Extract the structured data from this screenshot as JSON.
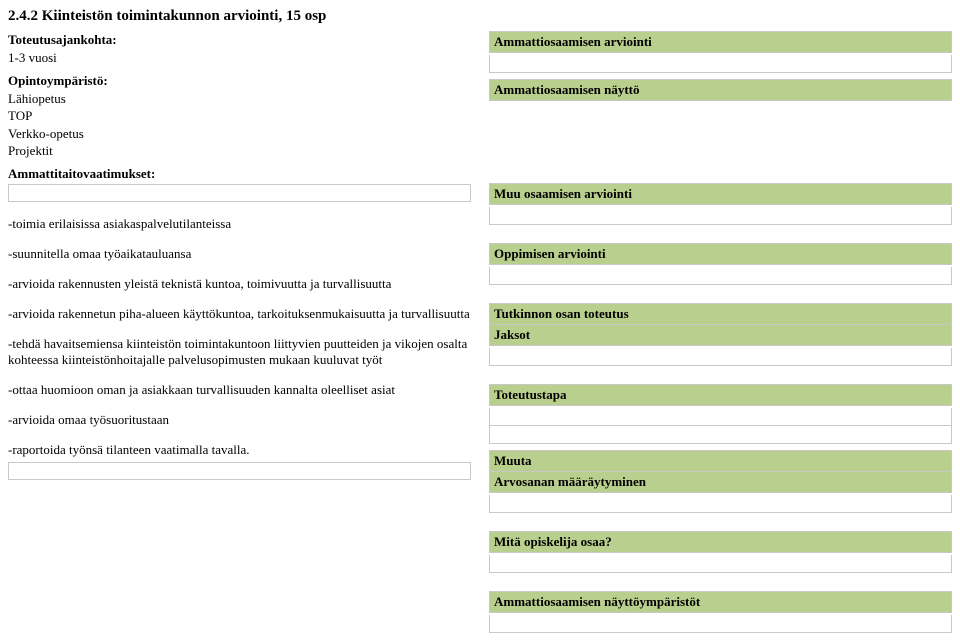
{
  "title": "2.4.2 Kiinteistön toimintakunnon arviointi, 15 osp",
  "left": {
    "toteutusajankohta_label": "Toteutusajankohta:",
    "toteutusajankohta_value": "1-3 vuosi",
    "opintoymparisto_label": "Opintoympäristö:",
    "opintoymparisto_items": [
      "Lähiopetus",
      "TOP",
      "Verkko-opetus",
      "Projektit"
    ],
    "ammattitaito_label": "Ammattitaitovaatimukset:",
    "item1": "-toimia erilaisissa asiakaspalvelutilanteissa",
    "item2": "-suunnitella omaa työaikatauluansa",
    "item3": "-arvioida rakennusten yleistä teknistä kuntoa, toimivuutta ja turvallisuutta",
    "item4": "-arvioida rakennetun piha-alueen käyttökuntoa, tarkoituksenmukaisuutta ja turvallisuutta",
    "item5": "-tehdä havaitsemiensa kiinteistön toimintakuntoon liittyvien puutteiden ja vikojen osalta kohteessa kiinteistönhoitajalle palvelusopimusten mukaan kuuluvat työt",
    "item6": "-ottaa huomioon oman ja asiakkaan turvallisuuden kannalta oleelliset asiat",
    "item7": "-arvioida omaa työsuoritustaan",
    "item8": "-raportoida työnsä tilanteen vaatimalla tavalla."
  },
  "right": {
    "h1": "Ammattiosaamisen arviointi",
    "h2": "Ammattiosaamisen näyttö",
    "h3": "Muu osaamisen arviointi",
    "h4": "Oppimisen arviointi",
    "h5": "Tutkinnon osan toteutus",
    "h6": "Jaksot",
    "h7": "Toteutustapa",
    "h8": "Muuta",
    "h9": "Arvosanan määräytyminen",
    "h10": "Mitä opiskelija osaa?",
    "h11": "Ammattiosaamisen näyttöympäristöt"
  }
}
